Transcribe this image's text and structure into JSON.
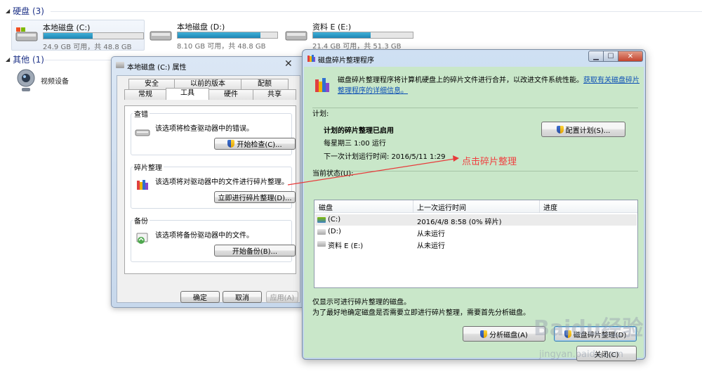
{
  "explorer": {
    "hard_disk_section": "硬盘 (3)",
    "other_section": "其他 (1)",
    "drives": [
      {
        "name": "本地磁盘 (C:)",
        "free": "24.9 GB 可用，共 48.8 GB",
        "used_fraction": 0.49
      },
      {
        "name": "本地磁盘 (D:)",
        "free": "8.10 GB 可用，共 48.8 GB",
        "used_fraction": 0.83
      },
      {
        "name": "资料 E (E:)",
        "free": "21.4 GB 可用，共 51.3 GB",
        "used_fraction": 0.58
      }
    ],
    "other_devices": [
      {
        "name": "视频设备"
      }
    ]
  },
  "props": {
    "title": "本地磁盘 (C:) 属性",
    "tabs_row1": [
      "安全",
      "以前的版本",
      "配额"
    ],
    "tabs_row2": [
      "常规",
      "工具",
      "硬件",
      "共享"
    ],
    "check": {
      "label": "查错",
      "text": "该选项将检查驱动器中的错误。",
      "button": "开始检查(C)..."
    },
    "defrag": {
      "label": "碎片整理",
      "text": "该选项将对驱动器中的文件进行碎片整理。",
      "button": "立即进行碎片整理(D)..."
    },
    "backup": {
      "label": "备份",
      "text": "该选项将备份驱动器中的文件。",
      "button": "开始备份(B)..."
    },
    "ok": "确定",
    "cancel": "取消",
    "apply": "应用(A)"
  },
  "defrag_window": {
    "title": "磁盘碎片整理程序",
    "description": "磁盘碎片整理程序将计算机硬盘上的碎片文件进行合并，以改进文件系统性能。",
    "link": "获取有关磁盘碎片整理程序的详细信息。",
    "schedule_label": "计划:",
    "schedule_enabled": "计划的碎片整理已启用",
    "schedule_freq": "每星期三 1:00 运行",
    "next_run": "下一次计划运行时间: 2016/5/11 1:29",
    "configure_button": "配置计划(S)...",
    "current_status": "当前状态(U):",
    "columns": [
      "磁盘",
      "上一次运行时间",
      "进度"
    ],
    "rows": [
      {
        "disk": "(C:)",
        "last_run": "2016/4/8 8:58 (0% 碎片)",
        "progress": ""
      },
      {
        "disk": "(D:)",
        "last_run": "从未运行",
        "progress": ""
      },
      {
        "disk": "资料 E (E:)",
        "last_run": "从未运行",
        "progress": ""
      }
    ],
    "note1": "仅显示可进行碎片整理的磁盘。",
    "note2": "为了最好地确定磁盘是否需要立即进行碎片整理，需要首先分析磁盘。",
    "analyze_button": "分析磁盘(A)",
    "defrag_button": "磁盘碎片整理(D)",
    "close_button": "关闭(C)"
  },
  "annotation": "点击碎片整理",
  "watermark": {
    "main": "Baidu经验",
    "sub": "jingyan.baidu.com"
  }
}
